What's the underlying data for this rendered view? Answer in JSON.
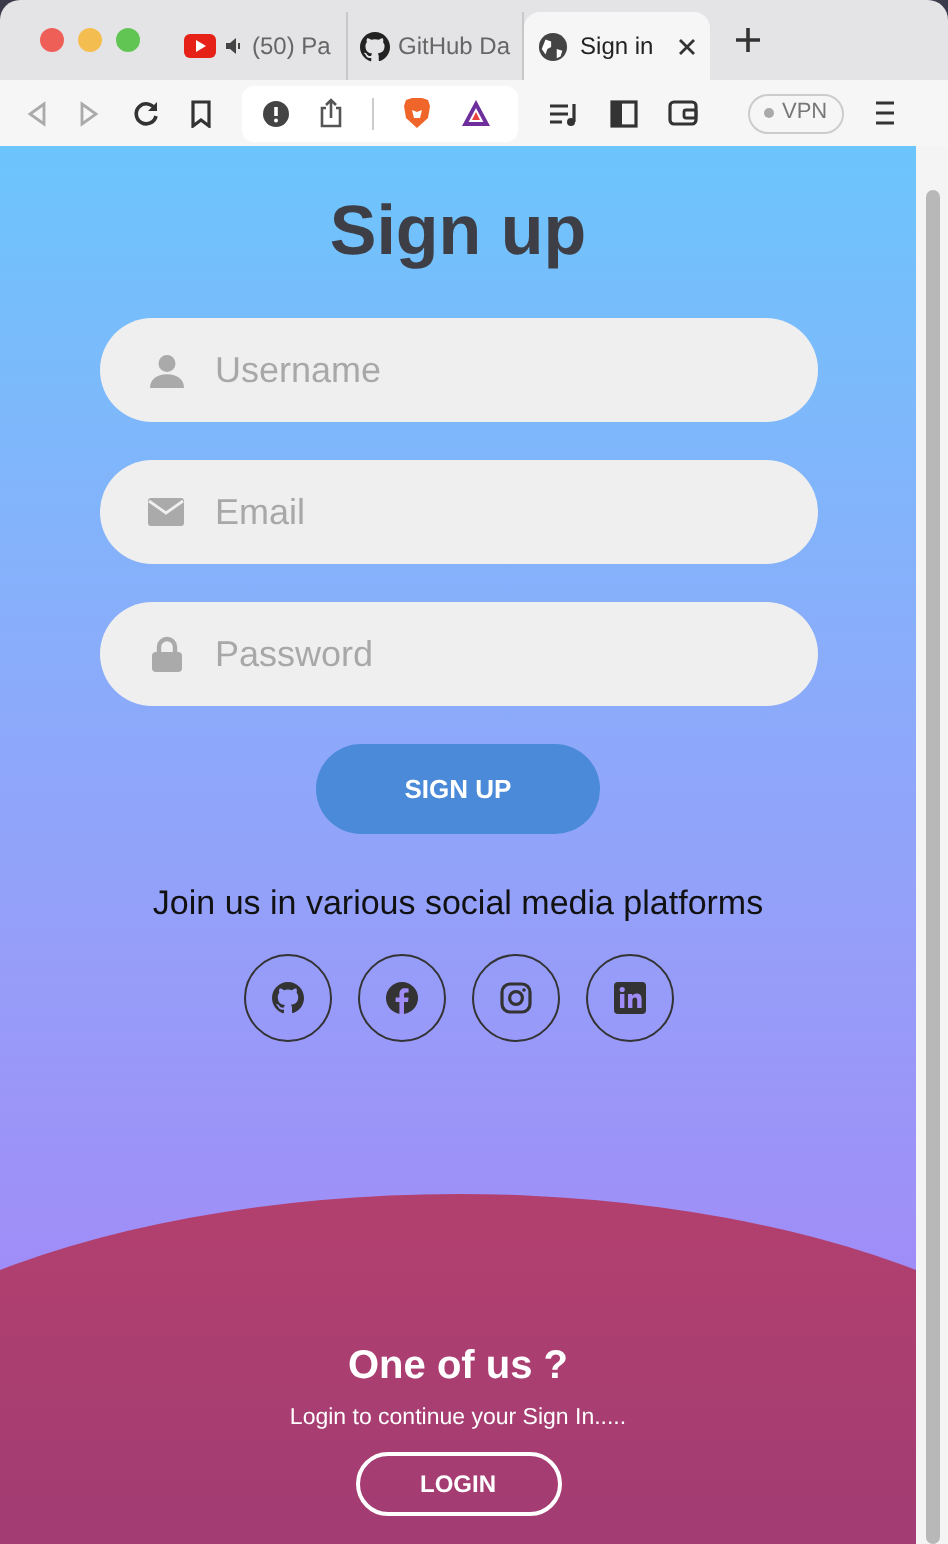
{
  "browser": {
    "tabs": [
      {
        "kind": "video",
        "title": "(50) Pa",
        "audio": true,
        "selected": false
      },
      {
        "kind": "code",
        "title": "GitHub Da",
        "audio": false,
        "selected": false
      },
      {
        "kind": "web",
        "title": "Sign in",
        "audio": false,
        "selected": true
      }
    ],
    "vpn_label": "VPN"
  },
  "page": {
    "title": "Sign up",
    "fields": [
      {
        "kind": "user",
        "placeholder": "Username"
      },
      {
        "kind": "email",
        "placeholder": "Email"
      },
      {
        "kind": "password",
        "placeholder": "Password"
      }
    ],
    "signup_button": "SIGN UP",
    "social_text": "Join us in various social media platforms",
    "socials": [
      {
        "kind": "github"
      },
      {
        "kind": "facebook"
      },
      {
        "kind": "instagram"
      },
      {
        "kind": "linkedin"
      }
    ],
    "panel": {
      "heading": "One of us ?",
      "text": "Login to continue your Sign In.....",
      "login_button": "LOGIN"
    }
  }
}
